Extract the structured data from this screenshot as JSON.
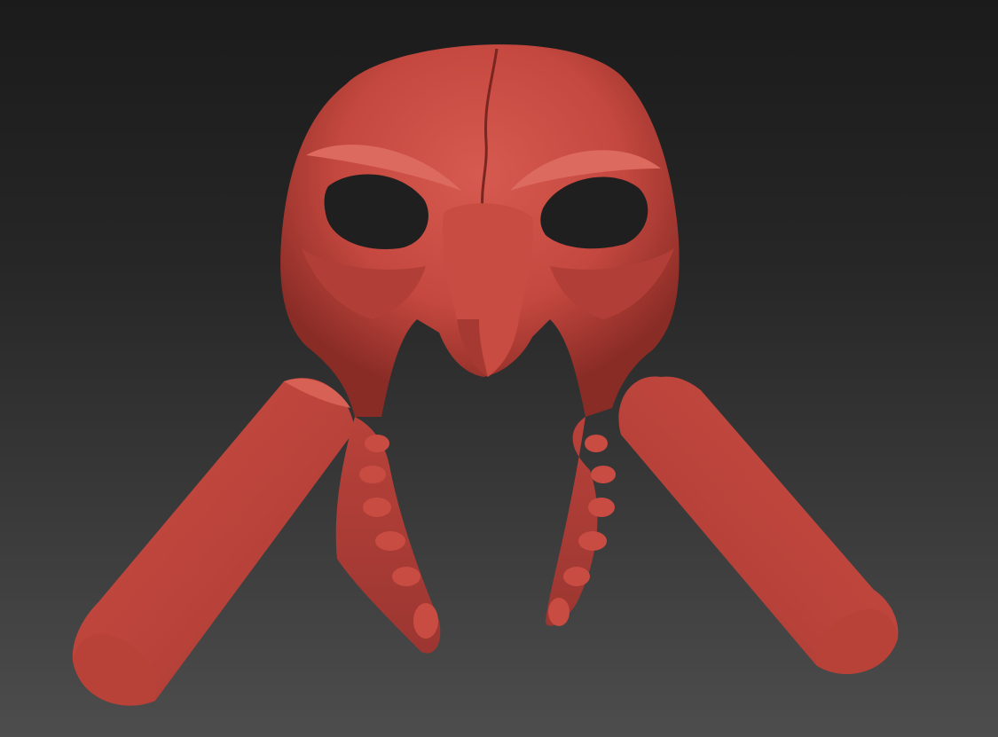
{
  "viewport": {
    "background_top": "#1b1b1b",
    "background_bottom": "#4d4d4d"
  },
  "model": {
    "subject": "skull-mask-sculpt",
    "material_color": "#c4483f",
    "shadow_color": "#7a2520",
    "highlight_color": "#e0766b"
  }
}
